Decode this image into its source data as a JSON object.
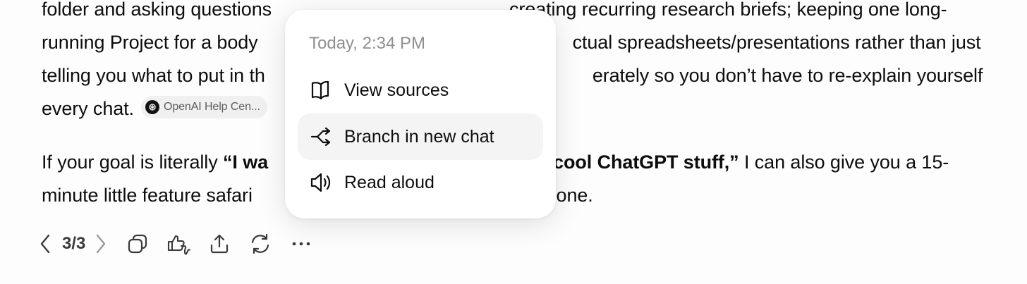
{
  "message": {
    "para1": {
      "line1a": "folder and asking questions",
      "line1b": "creating recurring research briefs; keeping one long-",
      "line2a": "running Project for a body",
      "line2b": "ctual spreadsheets/presentations rather than just",
      "line3a": "telling you what to put in th",
      "line3b": "erately so you don’t have to re-explain yourself",
      "line4": "every chat."
    },
    "source_chip": {
      "label": "OpenAI Help Cen..."
    },
    "para2": {
      "line1a": "If your goal is literally ",
      "line1_bold_a": "“I wa",
      "line1_bold_b": "over cool ChatGPT stuff,”",
      "line1b": " I can also give you a 15-",
      "line2a": "minute little feature safari",
      "line2b": "by one."
    }
  },
  "toolbar": {
    "pager": "3/3"
  },
  "popup": {
    "timestamp": "Today, 2:34 PM",
    "items": [
      {
        "label": "View sources",
        "icon": "book-open-icon"
      },
      {
        "label": "Branch in new chat",
        "icon": "branch-icon"
      },
      {
        "label": "Read aloud",
        "icon": "speaker-icon"
      }
    ]
  }
}
